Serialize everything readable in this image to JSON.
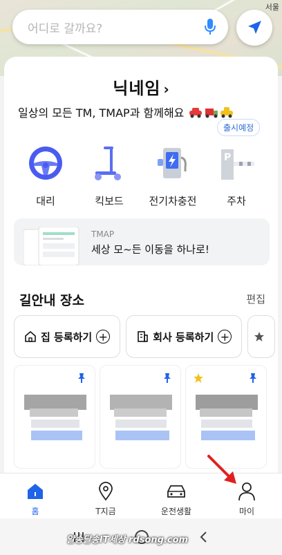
{
  "map": {
    "city_label": "서울"
  },
  "search": {
    "placeholder": "어디로 갈까요?"
  },
  "profile": {
    "nickname": "닉네임",
    "chevron": "›",
    "subtitle": "일상의 모든 TM, TMAP과 함께해요"
  },
  "services": [
    {
      "label": "대리",
      "icon": "steering-wheel-icon"
    },
    {
      "label": "킥보드",
      "icon": "kickboard-icon"
    },
    {
      "label": "전기차충전",
      "icon": "ev-charger-icon"
    },
    {
      "label": "주차",
      "icon": "parking-icon",
      "badge": "출시예정"
    }
  ],
  "banner": {
    "brand": "TMAP",
    "text": "세상 모~든 이동을 하나로!"
  },
  "places": {
    "title": "길안내 장소",
    "edit": "편집",
    "home_label": "집 등록하기",
    "work_label": "회사 등록하기",
    "plus": "+"
  },
  "bottom_nav": [
    {
      "label": "홈",
      "icon": "home-icon",
      "active": true
    },
    {
      "label": "T지금",
      "icon": "location-pin-icon"
    },
    {
      "label": "운전생활",
      "icon": "car-icon"
    },
    {
      "label": "마이",
      "icon": "person-icon"
    }
  ],
  "watermark": "알송달송IT세상 rdsong.com",
  "colors": {
    "accent": "#1f63e8",
    "arrow": "#e02020"
  }
}
